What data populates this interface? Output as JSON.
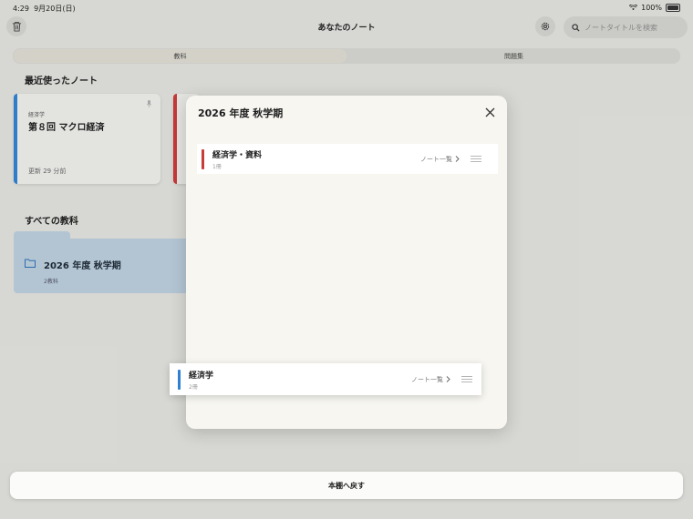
{
  "status_bar": {
    "time": "4:29",
    "date": "9月20日(日)",
    "battery": "100%"
  },
  "header": {
    "title": "あなたのノート",
    "search_placeholder": "ノートタイトルを検索"
  },
  "tabs": [
    {
      "label": "教科",
      "selected": true
    },
    {
      "label": "問題集",
      "selected": false
    }
  ],
  "recent": {
    "heading": "最近使ったノート",
    "card": {
      "subject": "経済学",
      "title": "第８回 マクロ経済",
      "updated": "更新 29 分前"
    }
  },
  "all_subjects": {
    "heading": "すべての教科",
    "folder": {
      "name": "2026 年度 秋学期",
      "count": "2教科"
    }
  },
  "modal": {
    "title": "2026 年度 秋学期",
    "items": [
      {
        "name": "経済学・資料",
        "count": "1冊",
        "link": "ノート一覧",
        "color": "#c93a3a"
      }
    ],
    "dragging_item": {
      "name": "経済学",
      "count": "2冊",
      "link": "ノート一覧",
      "color": "#2f80d0"
    }
  },
  "bottom_button": {
    "label": "本棚へ戻す"
  },
  "icons": {
    "trash": "trash-icon",
    "gear": "gear-icon",
    "search": "search-icon",
    "mic": "mic-icon",
    "folder": "folder-icon",
    "close": "close-icon",
    "chevron": "chevron-right-icon",
    "handle": "drag-handle-icon"
  }
}
